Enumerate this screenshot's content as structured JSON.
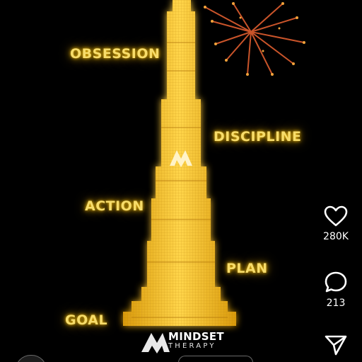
{
  "poster": {
    "words": [
      "OBSESSION",
      "DISCIPLINE",
      "ACTION",
      "PLAN",
      "GOAL"
    ],
    "glow_color": "#f7dc6a",
    "tower_color": "#f2b81c",
    "brand": {
      "name": "MINDSET",
      "subtitle": "THERAPY",
      "logo_icon": "mountain-logo-icon"
    }
  },
  "actions": {
    "like": {
      "icon": "heart-icon",
      "count": "280K"
    },
    "comment": {
      "icon": "comment-icon",
      "count": "213"
    },
    "share": {
      "icon": "send-icon"
    }
  }
}
